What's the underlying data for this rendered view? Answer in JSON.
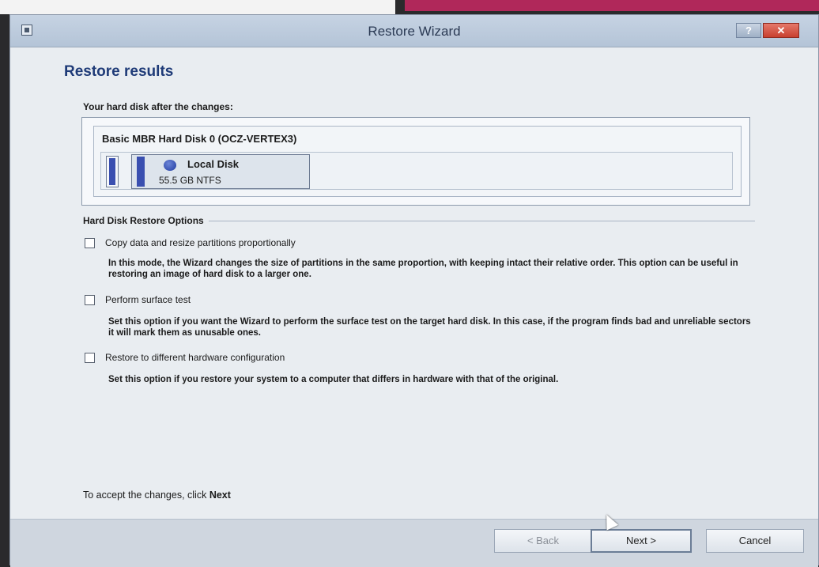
{
  "window": {
    "title": "Restore Wizard",
    "help_label": "?",
    "close_label": "✕"
  },
  "page": {
    "heading": "Restore results",
    "subheading": "Your hard disk after the changes:"
  },
  "disk": {
    "title": "Basic MBR Hard Disk 0 (OCZ-VERTEX3)",
    "partition": {
      "name": "Local Disk",
      "size": "55.5 GB NTFS"
    }
  },
  "options": {
    "section_label": "Hard Disk Restore Options",
    "items": [
      {
        "label": "Copy data and resize partitions proportionally",
        "checked": false,
        "description": "In this mode, the Wizard changes the size of partitions in the same proportion, with keeping intact their relative order. This option can be useful in restoring an image of hard disk to a larger one."
      },
      {
        "label": "Perform surface test",
        "checked": false,
        "description": "Set this option if you want the Wizard to perform the surface test on the target hard disk. In this case, if the program finds bad and unreliable sectors it will mark them as unusable ones."
      },
      {
        "label": "Restore to different hardware configuration",
        "checked": false,
        "description": "Set this option if you restore your system to a computer that differs in hardware with that of the original."
      }
    ]
  },
  "footer": {
    "text": "To accept the changes, click",
    "bold": "Next"
  },
  "buttons": {
    "back": "< Back",
    "next": "Next >",
    "cancel": "Cancel"
  }
}
